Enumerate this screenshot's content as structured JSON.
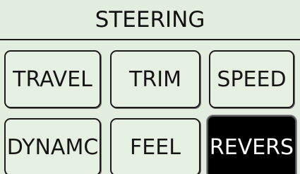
{
  "header": {
    "title": "STEERING"
  },
  "buttons": [
    {
      "label": "TRAVEL",
      "active": false
    },
    {
      "label": "TRIM",
      "active": false
    },
    {
      "label": "SPEED",
      "active": false
    },
    {
      "label": "DYNAMC",
      "active": false
    },
    {
      "label": "FEEL",
      "active": false
    },
    {
      "label": "REVERS",
      "active": true
    }
  ],
  "colors": {
    "background": "#e3eddf",
    "button_face": "#e6f0e2",
    "active_button_face": "#000000",
    "active_button_text": "#ffffff",
    "text": "#151515"
  }
}
